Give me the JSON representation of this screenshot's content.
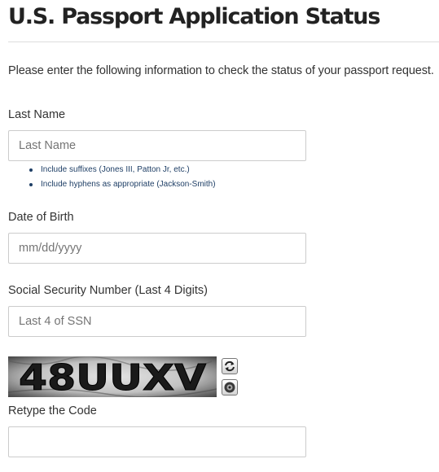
{
  "page": {
    "title": "U.S. Passport Application Status",
    "intro": "Please enter the following information to check the status of your passport request."
  },
  "last_name": {
    "label": "Last Name",
    "placeholder": "Last Name",
    "value": "",
    "hints": [
      "Include suffixes (Jones III, Patton Jr, etc.)",
      "Include hyphens as appropriate (Jackson-Smith)"
    ]
  },
  "dob": {
    "label": "Date of Birth",
    "placeholder": "mm/dd/yyyy",
    "value": ""
  },
  "ssn": {
    "label": "Social Security Number (Last 4 Digits)",
    "placeholder": "Last 4 of SSN",
    "value": ""
  },
  "captcha": {
    "code": "48UUXV",
    "refresh_icon": "refresh-icon",
    "audio_icon": "audio-icon",
    "retype_label": "Retype the Code",
    "retype_value": ""
  },
  "colors": {
    "hint_text": "#1f3f66",
    "field_border": "#cccccc",
    "title": "#222222"
  }
}
